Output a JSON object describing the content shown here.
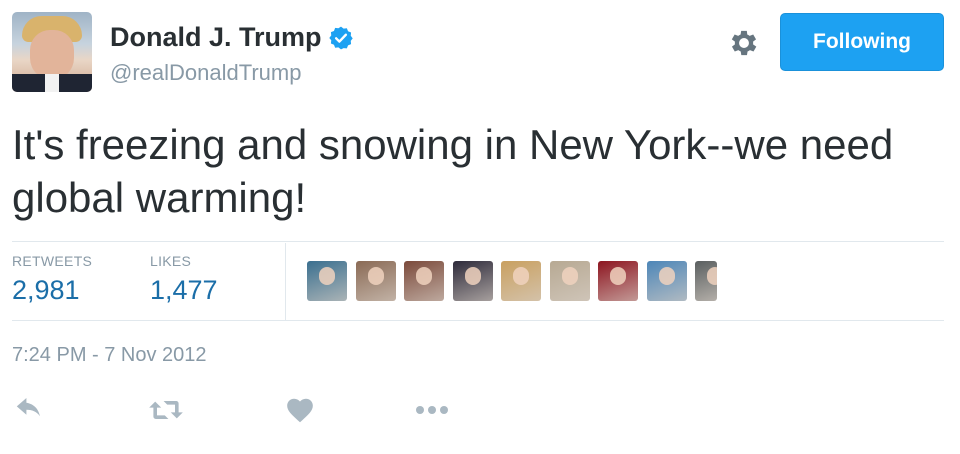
{
  "user": {
    "name": "Donald J. Trump",
    "handle": "@realDonaldTrump",
    "verified": true
  },
  "header": {
    "follow_label": "Following",
    "settings_icon": "gear-icon"
  },
  "tweet": {
    "text": "It's freezing and snowing in New York--we need global warming!"
  },
  "stats": {
    "retweets_label": "RETWEETS",
    "retweets_value": "2,981",
    "likes_label": "LIKES",
    "likes_value": "1,477"
  },
  "likers": [
    {
      "color": "#3a6f8f"
    },
    {
      "color": "#8a6a55"
    },
    {
      "color": "#7b4a3b"
    },
    {
      "color": "#2d2a3a"
    },
    {
      "color": "#c9a060"
    },
    {
      "color": "#b7a993"
    },
    {
      "color": "#8d1520"
    },
    {
      "color": "#4d86b8"
    },
    {
      "color": "#5a5f60"
    }
  ],
  "timestamp": "7:24 PM - 7 Nov 2012",
  "actions": {
    "icons": [
      "reply-icon",
      "retweet-icon",
      "like-icon",
      "more-icon"
    ]
  },
  "colors": {
    "accent": "#1da1f2",
    "link": "#1b6ea8",
    "muted": "#8899a6",
    "text": "#292f33",
    "divider": "#e1e8ed"
  }
}
